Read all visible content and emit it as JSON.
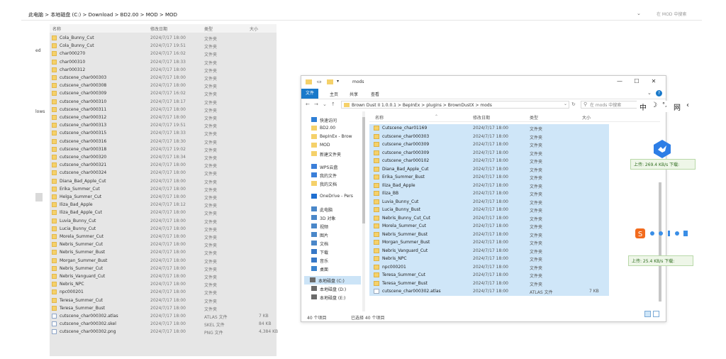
{
  "bg_window": {
    "address_path": "此电脑  >  本地磁盘 (C:)  >  Download  >  BD2.00  >  MOD  >  MOD",
    "search_placeholder": "在 MOD 中搜索",
    "columns": {
      "name": "名称",
      "date": "修改日期",
      "type": "类型",
      "size": "大小"
    },
    "left_edge": [
      "ed",
      "lows"
    ],
    "rows": [
      {
        "name": "Cola_Bunny_Cut",
        "date": "2024/7/17 18:00",
        "type": "文件夹",
        "size": ""
      },
      {
        "name": "Cola_Bunny_Cut",
        "date": "2024/7/17 19:51",
        "type": "文件夹",
        "size": ""
      },
      {
        "name": "char000270",
        "date": "2024/7/17 16:02",
        "type": "文件夹",
        "size": ""
      },
      {
        "name": "char000310",
        "date": "2024/7/17 18:33",
        "type": "文件夹",
        "size": ""
      },
      {
        "name": "char000312",
        "date": "2024/7/17 18:00",
        "type": "文件夹",
        "size": ""
      },
      {
        "name": "cutscene_char000303",
        "date": "2024/7/17 18:00",
        "type": "文件夹",
        "size": ""
      },
      {
        "name": "cutscene_char000308",
        "date": "2024/7/17 18:00",
        "type": "文件夹",
        "size": ""
      },
      {
        "name": "cutscene_char000309",
        "date": "2024/7/17 16:02",
        "type": "文件夹",
        "size": ""
      },
      {
        "name": "cutscene_char000310",
        "date": "2024/7/17 18:17",
        "type": "文件夹",
        "size": ""
      },
      {
        "name": "cutscene_char000311",
        "date": "2024/7/17 18:00",
        "type": "文件夹",
        "size": ""
      },
      {
        "name": "cutscene_char000312",
        "date": "2024/7/17 18:00",
        "type": "文件夹",
        "size": ""
      },
      {
        "name": "cutscene_char000313",
        "date": "2024/7/17 19:51",
        "type": "文件夹",
        "size": ""
      },
      {
        "name": "cutscene_char000315",
        "date": "2024/7/17 18:33",
        "type": "文件夹",
        "size": ""
      },
      {
        "name": "cutscene_char000316",
        "date": "2024/7/17 18:30",
        "type": "文件夹",
        "size": ""
      },
      {
        "name": "cutscene_char000318",
        "date": "2024/7/17 19:02",
        "type": "文件夹",
        "size": ""
      },
      {
        "name": "cutscene_char000320",
        "date": "2024/7/17 18:34",
        "type": "文件夹",
        "size": ""
      },
      {
        "name": "cutscene_char000321",
        "date": "2024/7/17 18:00",
        "type": "文件夹",
        "size": ""
      },
      {
        "name": "cutscene_char000324",
        "date": "2024/7/17 18:00",
        "type": "文件夹",
        "size": ""
      },
      {
        "name": "Diana_Bad_Apple_Cut",
        "date": "2024/7/17 18:00",
        "type": "文件夹",
        "size": ""
      },
      {
        "name": "Erika_Summer_Cut",
        "date": "2024/7/17 18:00",
        "type": "文件夹",
        "size": ""
      },
      {
        "name": "Helga_Summer_Cut",
        "date": "2024/7/17 18:00",
        "type": "文件夹",
        "size": ""
      },
      {
        "name": "Iliza_Bad_Apple",
        "date": "2024/7/17 18:12",
        "type": "文件夹",
        "size": ""
      },
      {
        "name": "Iliza_Bad_Apple_Cut",
        "date": "2024/7/17 18:00",
        "type": "文件夹",
        "size": ""
      },
      {
        "name": "Luvia_Bunny_Cut",
        "date": "2024/7/17 18:00",
        "type": "文件夹",
        "size": ""
      },
      {
        "name": "Lucia_Bunny_Cut",
        "date": "2024/7/17 18:00",
        "type": "文件夹",
        "size": ""
      },
      {
        "name": "Morela_Summer_Cut",
        "date": "2024/7/17 18:00",
        "type": "文件夹",
        "size": ""
      },
      {
        "name": "Nebris_Summer_Cut",
        "date": "2024/7/17 18:00",
        "type": "文件夹",
        "size": ""
      },
      {
        "name": "Nebris_Summer_Bust",
        "date": "2024/7/17 18:00",
        "type": "文件夹",
        "size": ""
      },
      {
        "name": "Morgan_Summer_Bust",
        "date": "2024/7/17 18:00",
        "type": "文件夹",
        "size": ""
      },
      {
        "name": "Nebris_Summer_Cut",
        "date": "2024/7/17 18:00",
        "type": "文件夹",
        "size": ""
      },
      {
        "name": "Nebris_Vanguard_Cut",
        "date": "2024/7/17 18:00",
        "type": "文件夹",
        "size": ""
      },
      {
        "name": "Nebris_NPC",
        "date": "2024/7/17 18:00",
        "type": "文件夹",
        "size": ""
      },
      {
        "name": "npc000201",
        "date": "2024/7/17 18:00",
        "type": "文件夹",
        "size": ""
      },
      {
        "name": "Teresa_Summer_Cut",
        "date": "2024/7/17 18:00",
        "type": "文件夹",
        "size": ""
      },
      {
        "name": "Teresa_Summer_Bust",
        "date": "2024/7/17 18:00",
        "type": "文件夹",
        "size": ""
      },
      {
        "name": "cutscene_char000302.atlas",
        "date": "2024/7/17 18:00",
        "type": "ATLAS 文件",
        "size": "7 KB",
        "file": true
      },
      {
        "name": "cutscene_char000302.skel",
        "date": "2024/7/17 18:00",
        "type": "SKEL 文件",
        "size": "84 KB",
        "file": true
      },
      {
        "name": "cutscene_char000302.png",
        "date": "2024/7/17 18:00",
        "type": "PNG 文件",
        "size": "4,384 KB",
        "file": true
      }
    ]
  },
  "window": {
    "title": "mods",
    "tabs": {
      "file": "文件",
      "home": "主页",
      "share": "共享",
      "view": "查看"
    },
    "address_path": "Brown Dust II  1.0.0.1  >  BepInEx  >  plugins  >  BrownDustX  >  mods",
    "search_placeholder": "在 mods 中搜索",
    "columns": {
      "name": "名称",
      "date": "修改日期",
      "type": "类型",
      "size": "大小"
    },
    "nav": [
      {
        "label": "快速访问",
        "icon": "star-icon",
        "color": "#2f7fd6"
      },
      {
        "label": "BD2.00",
        "icon": "folder-icon",
        "color": "#f5d16a"
      },
      {
        "label": "BepInEx - Brow",
        "icon": "folder-icon",
        "color": "#f5d16a"
      },
      {
        "label": "MOD",
        "icon": "folder-icon",
        "color": "#f5d16a"
      },
      {
        "label": "新建文件夹",
        "icon": "folder-icon",
        "color": "#f5d16a"
      },
      {
        "label": "WPS云盘",
        "icon": "cloud-icon",
        "color": "#3b7fd9"
      },
      {
        "label": "我的文件",
        "icon": "cloud-icon",
        "color": "#3b7fd9"
      },
      {
        "label": "我的文档",
        "icon": "folder-icon",
        "color": "#f5d16a"
      },
      {
        "label": "OneDrive - Pers",
        "icon": "onedrive-icon",
        "color": "#1f6fd1"
      },
      {
        "label": "此电脑",
        "icon": "pc-icon",
        "color": "#4a87c9"
      },
      {
        "label": "3D 对象",
        "icon": "cube-icon",
        "color": "#4a87c9"
      },
      {
        "label": "视频",
        "icon": "video-icon",
        "color": "#4a87c9"
      },
      {
        "label": "图片",
        "icon": "image-icon",
        "color": "#4a87c9"
      },
      {
        "label": "文档",
        "icon": "doc-icon",
        "color": "#4a87c9"
      },
      {
        "label": "下载",
        "icon": "download-icon",
        "color": "#3778c7"
      },
      {
        "label": "音乐",
        "icon": "music-icon",
        "color": "#3778c7"
      },
      {
        "label": "桌面",
        "icon": "desktop-icon",
        "color": "#3b84cf"
      },
      {
        "label": "本地磁盘 (C:)",
        "icon": "drive-icon",
        "color": "#6b6b6b",
        "selected": true
      },
      {
        "label": "本地磁盘 (D:)",
        "icon": "drive-icon",
        "color": "#6b6b6b"
      },
      {
        "label": "本地磁盘 (E:)",
        "icon": "drive-icon",
        "color": "#6b6b6b"
      }
    ],
    "rows": [
      {
        "name": "Cutscene_char01169",
        "date": "2024/7/17 18:00",
        "type": "文件夹",
        "size": ""
      },
      {
        "name": "cutscene_char000303",
        "date": "2024/7/17 18:00",
        "type": "文件夹",
        "size": ""
      },
      {
        "name": "cutscene_char000309",
        "date": "2024/7/17 18:00",
        "type": "文件夹",
        "size": ""
      },
      {
        "name": "cutscene_char000309",
        "date": "2024/7/17 18:00",
        "type": "文件夹",
        "size": ""
      },
      {
        "name": "cutscene_char000102",
        "date": "2024/7/17 18:00",
        "type": "文件夹",
        "size": ""
      },
      {
        "name": "Diana_Bad_Apple_Cut",
        "date": "2024/7/17 18:00",
        "type": "文件夹",
        "size": ""
      },
      {
        "name": "Erika_Summer_Bust",
        "date": "2024/7/17 18:00",
        "type": "文件夹",
        "size": ""
      },
      {
        "name": "Iliza_Bad_Apple",
        "date": "2024/7/17 18:00",
        "type": "文件夹",
        "size": ""
      },
      {
        "name": "Iliza_BB",
        "date": "2024/7/17 18:00",
        "type": "文件夹",
        "size": ""
      },
      {
        "name": "Luvia_Bunny_Cut",
        "date": "2024/7/17 18:00",
        "type": "文件夹",
        "size": ""
      },
      {
        "name": "Lucia_Bunny_Bust",
        "date": "2024/7/17 18:00",
        "type": "文件夹",
        "size": ""
      },
      {
        "name": "Nebris_Bunny_Cut_Cut",
        "date": "2024/7/17 18:00",
        "type": "文件夹",
        "size": ""
      },
      {
        "name": "Morela_Summer_Cut",
        "date": "2024/7/17 18:00",
        "type": "文件夹",
        "size": ""
      },
      {
        "name": "Nebris_Summer_Bust",
        "date": "2024/7/17 18:00",
        "type": "文件夹",
        "size": ""
      },
      {
        "name": "Morgan_Summer_Bust",
        "date": "2024/7/17 18:00",
        "type": "文件夹",
        "size": ""
      },
      {
        "name": "Nebris_Vanguard_Cut",
        "date": "2024/7/17 18:00",
        "type": "文件夹",
        "size": ""
      },
      {
        "name": "Nebris_NPC",
        "date": "2024/7/17 18:00",
        "type": "文件夹",
        "size": ""
      },
      {
        "name": "npc000201",
        "date": "2024/7/17 18:00",
        "type": "文件夹",
        "size": ""
      },
      {
        "name": "Teresa_Summer_Cut",
        "date": "2024/7/17 18:00",
        "type": "文件夹",
        "size": ""
      },
      {
        "name": "Teresa_Summer_Bust",
        "date": "2024/7/17 18:00",
        "type": "文件夹",
        "size": ""
      },
      {
        "name": "cutscene_char000302.atlas",
        "date": "2024/7/17 18:00",
        "type": "ATLAS 文件",
        "size": "7 KB",
        "file": true
      }
    ],
    "status": {
      "count": "40 个项目",
      "selected": "已选择 40 个项目"
    }
  },
  "ime": {
    "lang": "中",
    "moon": "☽",
    "punct": "°,",
    "grid": "网",
    "more": "‹"
  },
  "speed1": "上传: 269.4 KB/s  下载:",
  "speed2": "上传: 25.4 KB/s  下载:",
  "colors": {
    "accent": "#1979ca",
    "selection": "#cfe6f8",
    "folder": "#f5d16a"
  }
}
